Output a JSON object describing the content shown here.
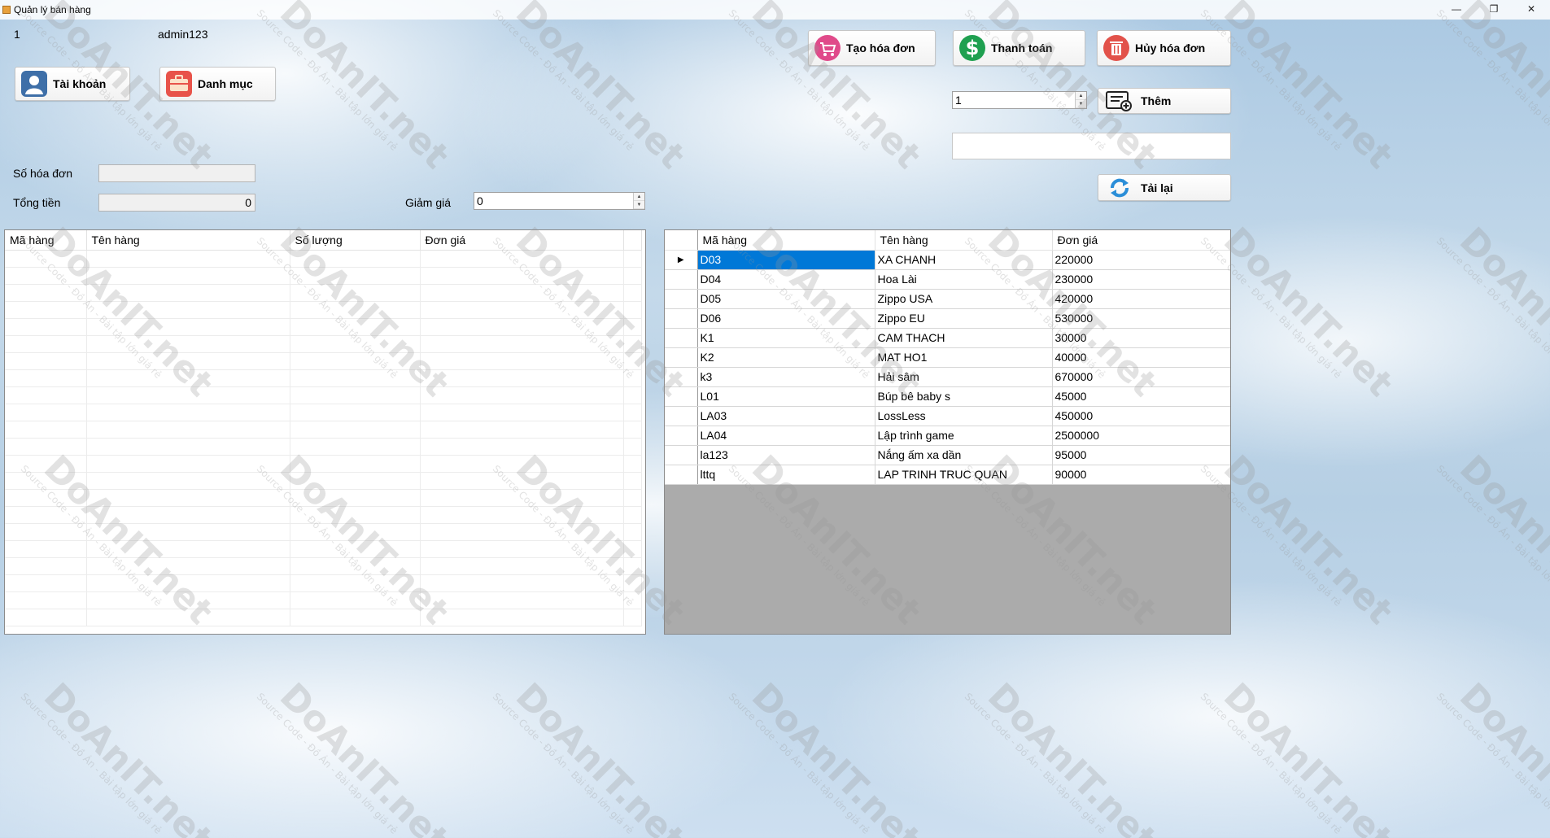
{
  "window": {
    "title": "Quản lý bán hàng",
    "controls": {
      "minimize": "—",
      "restore": "❐",
      "close": "✕"
    }
  },
  "header": {
    "id": "1",
    "username": "admin123"
  },
  "nav": {
    "account_label": "Tài khoản",
    "catalog_label": "Danh mục"
  },
  "invoice": {
    "number_label": "Số hóa đơn",
    "number_value": "",
    "total_label": "Tổng tiền",
    "total_value": "0",
    "discount_label": "Giảm giá",
    "discount_value": "0"
  },
  "actions": {
    "create_label": "Tạo hóa đơn",
    "pay_label": "Thanh toán",
    "cancel_label": "Hủy hóa đơn",
    "quantity_value": "1",
    "add_label": "Thêm",
    "reload_label": "Tải lại"
  },
  "invoice_grid": {
    "columns": [
      "Mã hàng",
      "Tên hàng",
      "Số lượng",
      "Đơn giá"
    ]
  },
  "product_grid": {
    "columns": [
      "Mã hàng",
      "Tên hàng",
      "Đơn giá"
    ],
    "selected_row": 0,
    "rows": [
      [
        "D03",
        "XA CHANH",
        "220000"
      ],
      [
        "D04",
        "Hoa Lài",
        "230000"
      ],
      [
        "D05",
        "Zippo USA",
        "420000"
      ],
      [
        "D06",
        "Zippo EU",
        "530000"
      ],
      [
        "K1",
        "CAM THACH",
        "30000"
      ],
      [
        "K2",
        "MAT HO1",
        "40000"
      ],
      [
        "k3",
        "Hải sâm",
        "670000"
      ],
      [
        "L01",
        "Búp bê baby s",
        "45000"
      ],
      [
        "LA03",
        "LossLess",
        "450000"
      ],
      [
        "LA04",
        "Lập trình game",
        "2500000"
      ],
      [
        "la123",
        "Nắng ấm xa dần",
        "95000"
      ],
      [
        "lttq",
        "LAP TRINH TRUC QUAN",
        "90000"
      ]
    ]
  },
  "watermark": {
    "text": "DoAnIT.net",
    "subtext": "Source Code - Đồ Án - Bài tập lớn giá rẻ"
  }
}
